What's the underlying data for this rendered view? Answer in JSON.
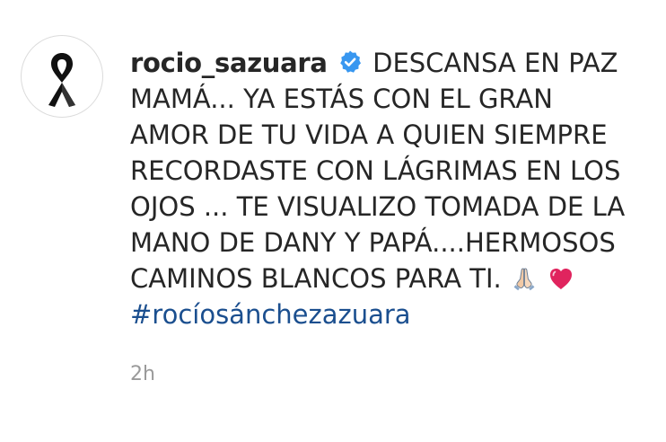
{
  "post": {
    "username": "rocio_sazuara",
    "verified_icon": "verified-badge-icon",
    "caption": "DESCANSA EN PAZ MAMÁ... YA ESTÁS CON EL GRAN AMOR DE TU VIDA A QUIEN SIEMPRE RECORDASTE CON LÁGRIMAS EN LOS OJOS ... TE VISUALIZO TOMADA DE LA MANO DE DANY Y PAPÁ....HERMOSOS CAMINOS BLANCOS PARA TI.",
    "emojis": [
      "folded-hands-icon",
      "red-heart-icon"
    ],
    "hashtag": "#rocíosánchezazuara",
    "timestamp": "2h",
    "avatar_icon": "black-ribbon-icon"
  },
  "colors": {
    "text": "#262626",
    "hashtag": "#1b4f8f",
    "verified": "#3897f0",
    "heart": "#e0245e",
    "timestamp": "#9a9a9a"
  }
}
